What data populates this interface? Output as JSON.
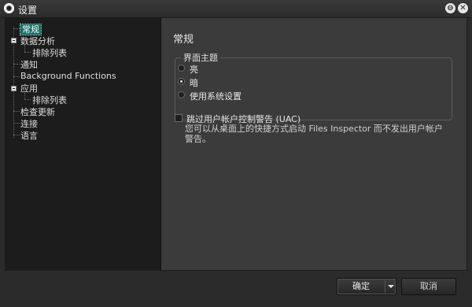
{
  "window": {
    "title": "设置",
    "minimize_glyph": "⊖",
    "close_glyph": "✕"
  },
  "tree": {
    "items": [
      {
        "label": "常规",
        "level": 0,
        "selected": true
      },
      {
        "label": "数据分析",
        "level": 0,
        "expanded": true
      },
      {
        "label": "排除列表",
        "level": 1
      },
      {
        "label": "通知",
        "level": 0
      },
      {
        "label": "Background Functions",
        "level": 0
      },
      {
        "label": "应用",
        "level": 0,
        "expanded": true
      },
      {
        "label": "排除列表",
        "level": 1
      },
      {
        "label": "检查更新",
        "level": 0
      },
      {
        "label": "连接",
        "level": 0
      },
      {
        "label": "语言",
        "level": 0
      }
    ]
  },
  "general": {
    "title": "常规",
    "theme_group_label": "界面主题",
    "theme_options": [
      {
        "label": "亮",
        "checked": false
      },
      {
        "label": "暗",
        "checked": true
      },
      {
        "label": "使用系统设置",
        "checked": false
      }
    ],
    "uac_checkbox_label": "跳过用户帐户控制警告 (UAC)",
    "uac_checked": false,
    "uac_description": "您可以从桌面上的快捷方式启动 Files Inspector 而不发出用户帐户警告。"
  },
  "footer": {
    "ok_label": "确定",
    "cancel_label": "取消"
  },
  "colors": {
    "selection": "#1a6d67",
    "background": "#3b3b3b",
    "tree_background": "#1c1c1c"
  }
}
